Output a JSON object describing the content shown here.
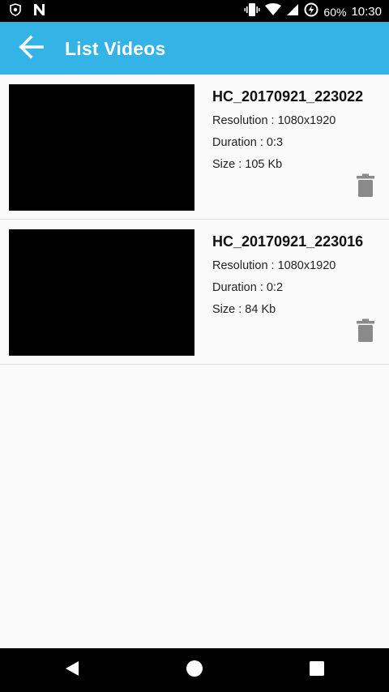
{
  "status_bar": {
    "battery_percent": "60%",
    "time": "10:30",
    "icons": [
      "shield-icon",
      "n-notification-icon",
      "vibrate-icon",
      "wifi-icon",
      "signal-icon",
      "battery-charging-icon"
    ]
  },
  "app_bar": {
    "title": "List Videos",
    "back_icon": "arrow-back-icon",
    "color": "#33b3e6"
  },
  "videos": [
    {
      "title": "HC_20170921_223022",
      "resolution": "Resolution : 1080x1920",
      "duration": "Duration : 0:3",
      "size": "Size : 105 Kb"
    },
    {
      "title": "HC_20170921_223016",
      "resolution": "Resolution : 1080x1920",
      "duration": "Duration : 0:2",
      "size": "Size : 84 Kb"
    }
  ],
  "nav_bar": {
    "icons": [
      "nav-back-icon",
      "nav-home-icon",
      "nav-recents-icon"
    ]
  }
}
